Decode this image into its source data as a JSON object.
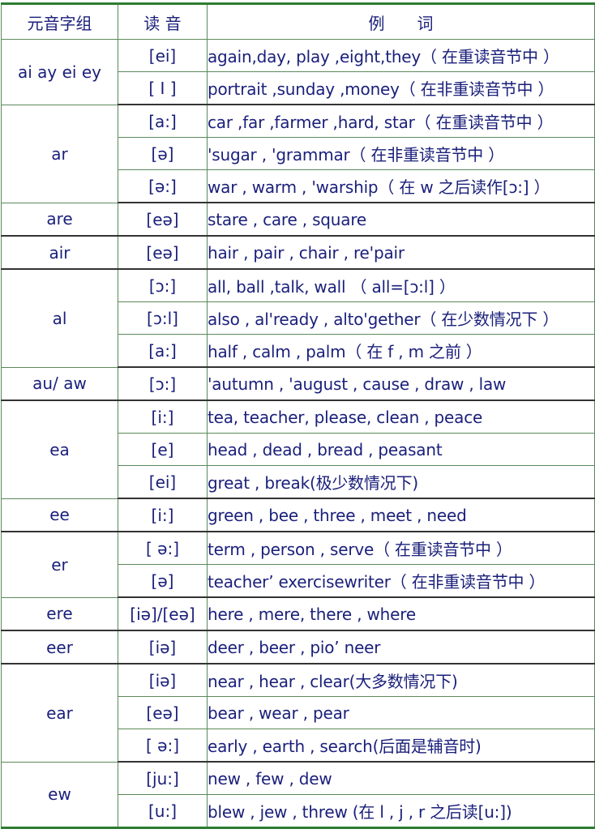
{
  "header": {
    "group": "元音字组",
    "pron": "读 音",
    "examples": "例　　词"
  },
  "groups": [
    {
      "name": "ai ay ei ey",
      "rows": [
        {
          "pron": "[ei]",
          "ex": "again,day, play ,eight,they（ 在重读音节中 ）"
        },
        {
          "pron": "[ I ]",
          "ex": "portrait ,sunday ,money（ 在非重读音节中 ）"
        }
      ]
    },
    {
      "name": "ar",
      "rows": [
        {
          "pron": "[a:]",
          "ex": "car ,far ,farmer ,hard, star（ 在重读音节中 ）"
        },
        {
          "pron": "[ə]",
          "ex": "'sugar ,  'grammar（ 在非重读音节中 ）"
        },
        {
          "pron": "[ə:]",
          "ex": "war , warm , 'warship（ 在 w 之后读作[ɔ:] ）"
        }
      ]
    },
    {
      "name": "are",
      "rows": [
        {
          "pron": "[eə]",
          "ex": "stare , care , square"
        }
      ]
    },
    {
      "name": "air",
      "rows": [
        {
          "pron": "[eə]",
          "ex": "hair , pair , chair , re'pair"
        }
      ]
    },
    {
      "name": "al",
      "rows": [
        {
          "pron": "[ɔ:]",
          "ex": "all, ball ,talk, wall  （   all=[ɔ:l] ）"
        },
        {
          "pron": "[ɔ:l]",
          "ex": "also , al'ready , alto'gether（ 在少数情况下 ）"
        },
        {
          "pron": "[a:]",
          "ex": "half , calm , palm（ 在 f , m 之前 ）"
        }
      ]
    },
    {
      "name": "au/ aw",
      "rows": [
        {
          "pron": "[ɔ:]",
          "ex": "'autumn , 'august , cause ,  draw , law"
        }
      ]
    },
    {
      "name": "ea",
      "rows": [
        {
          "pron": "[i:]",
          "ex": "tea, teacher, please, clean , peace"
        },
        {
          "pron": "[e]",
          "ex": "head , dead , bread , peasant"
        },
        {
          "pron": "[ei]",
          "ex": "great , break(极少数情况下)"
        }
      ]
    },
    {
      "name": "ee",
      "rows": [
        {
          "pron": "[i:]",
          "ex": "green , bee , three ,  meet ,  need"
        }
      ]
    },
    {
      "name": "er",
      "rows": [
        {
          "pron": "[ ə:]",
          "ex": "term , person , serve（ 在重读音节中 ）"
        },
        {
          "pron": "[ə]",
          "ex": "teacher’ exercisewriter（ 在非重读音节中 ）"
        }
      ]
    },
    {
      "name": "ere",
      "rows": [
        {
          "pron": "[iə]/[eə]",
          "ex": "here , mere, there , where"
        }
      ]
    },
    {
      "name": "eer",
      "rows": [
        {
          "pron": "[iə]",
          "ex": "deer , beer , pio’ neer"
        }
      ]
    },
    {
      "name": "ear",
      "rows": [
        {
          "pron": "[iə]",
          "ex": "near , hear , clear(大多数情况下)"
        },
        {
          "pron": "[eə]",
          "ex": "bear , wear , pear"
        },
        {
          "pron": "[ ə:]",
          "ex": "early , earth , search(后面是辅音时)"
        }
      ]
    },
    {
      "name": "ew",
      "rows": [
        {
          "pron": "[ju:]",
          "ex": "new , few , dew"
        },
        {
          "pron": "[u:]",
          "ex": "blew , jew , threw (在 l , j , r 之后读[u:])"
        }
      ]
    }
  ]
}
